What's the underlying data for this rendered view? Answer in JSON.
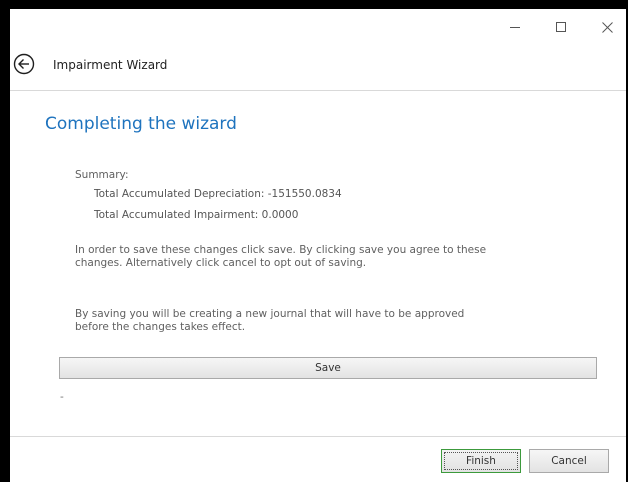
{
  "window": {
    "minimize_glyph": "–",
    "maximize_glyph": "☐",
    "close_glyph": "✕"
  },
  "header": {
    "title": "Impairment Wizard"
  },
  "main": {
    "heading": "Completing the wizard",
    "summary_label": "Summary:",
    "summary_lines": [
      "Total Accumulated Depreciation: -151550.0834",
      "Total Accumulated Impairment: 0.0000"
    ],
    "paragraphs": [
      "In order to save these changes click save. By clicking save you agree to these changes. Alternatively click cancel to opt out of saving.",
      "By saving you will be creating a new journal that will have to be approved before the changes takes effect."
    ],
    "save_label": "Save",
    "status_text": "-"
  },
  "footer": {
    "finish_label": "Finish",
    "cancel_label": "Cancel"
  },
  "colors": {
    "heading": "#1e73be",
    "finish_border": "#3c9a3c",
    "frame": "#000000"
  },
  "icons": {
    "back": "back-arrow-circle-icon",
    "minimize": "minimize-icon",
    "maximize": "maximize-icon",
    "close": "close-icon"
  }
}
